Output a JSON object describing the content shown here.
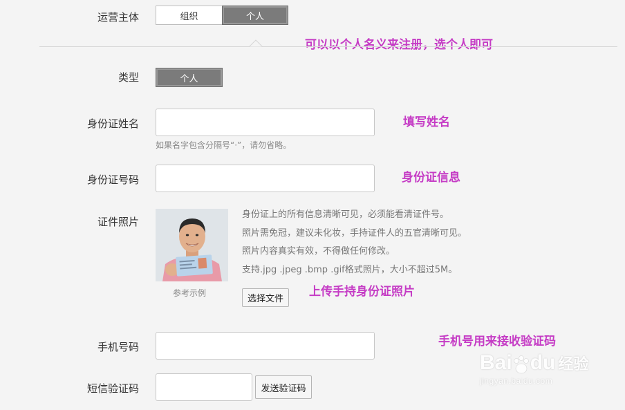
{
  "operator": {
    "label": "运营主体",
    "options": [
      "组织",
      "个人"
    ],
    "selected": "个人",
    "note": "可以以个人名义来注册，选个人即可"
  },
  "type": {
    "label": "类型",
    "value": "个人"
  },
  "id_name": {
    "label": "身份证姓名",
    "value": "",
    "hint": "如果名字包含分隔号“·”，请勿省略。",
    "note": "填写姓名"
  },
  "id_number": {
    "label": "身份证号码",
    "value": "",
    "note": "身份证信息"
  },
  "id_photo": {
    "label": "证件照片",
    "sample_caption": "参考示例",
    "info": [
      "身份证上的所有信息清晰可见，必须能看清证件号。",
      "照片需免冠，建议未化妆，手持证件人的五官清晰可见。",
      "照片内容真实有效，不得做任何修改。",
      "支持.jpg .jpeg .bmp .gif格式照片，大小不超过5M。"
    ],
    "choose_file": "选择文件",
    "note": "上传手持身份证照片"
  },
  "phone": {
    "label": "手机号码",
    "value": "",
    "note": "手机号用来接收验证码"
  },
  "sms_code": {
    "label": "短信验证码",
    "value": "",
    "send_button": "发送验证码"
  },
  "watermark": {
    "brand": "Bai",
    "brand2": "du",
    "cn": "经验",
    "url": "jingyan.baidu.com"
  }
}
